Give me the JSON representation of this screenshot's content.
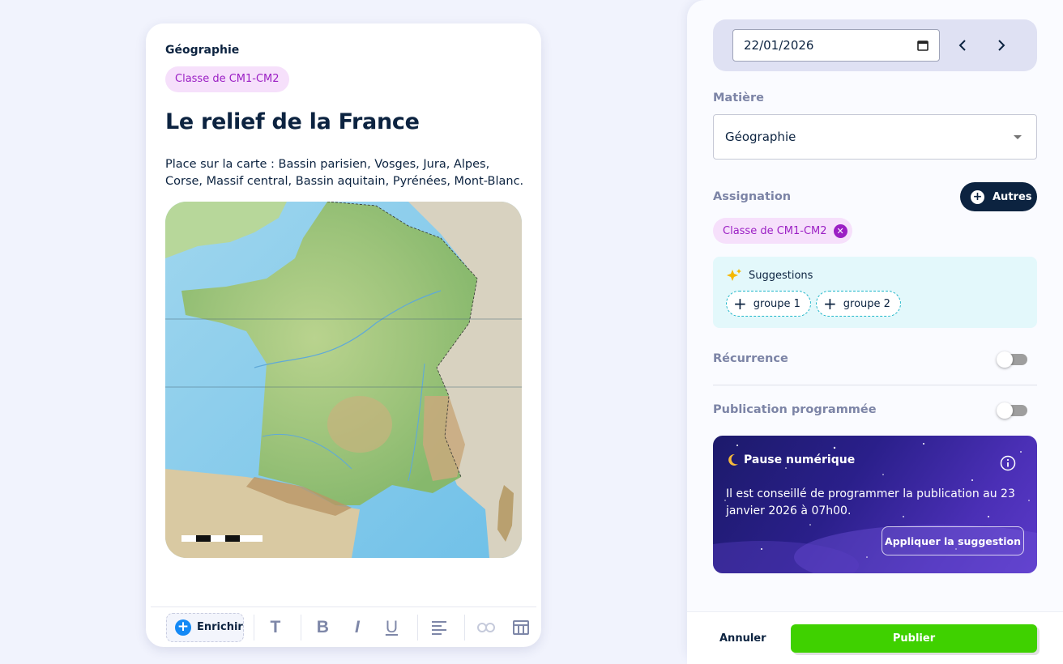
{
  "card": {
    "subject": "Géographie",
    "class_tag": "Classe de CM1-CM2",
    "title": "Le relief de la France",
    "description": "Place sur la carte : Bassin parisien, Vosges, Jura, Alpes, Corse, Massif central, Bassin aquitain, Pyrénées, Mont-Blanc.",
    "image_icon": "map-of-france-relief",
    "toolbar": {
      "enrich_label": "Enrichir",
      "tools": [
        "text-icon",
        "bold-icon",
        "italic-icon",
        "underline-icon",
        "align-left-icon",
        "link-icon",
        "table-icon"
      ]
    }
  },
  "panel": {
    "date_value": "22/01/2026",
    "matiere_label": "Matière",
    "matiere_value": "Géographie",
    "assignation_label": "Assignation",
    "autres_label": "Autres",
    "assigned_chip": "Classe de CM1-CM2",
    "suggestions_label": "Suggestions",
    "suggestions": [
      "groupe 1",
      "groupe 2"
    ],
    "recurrence_label": "Récurrence",
    "recurrence_on": false,
    "scheduled_label": "Publication programmée",
    "scheduled_on": false,
    "pause": {
      "title": "Pause numérique",
      "text": "Il est conseillé de programmer la publication au 23 janvier 2026 à 07h00.",
      "button": "Appliquer la suggestion"
    },
    "cancel_label": "Annuler",
    "publish_label": "Publier"
  },
  "colors": {
    "page_bg": "#f1f3fd",
    "navy": "#0c2340",
    "purple_tag": "#9b1fc4",
    "tag_bg": "#f6e0fb",
    "publish_green": "#3fd100",
    "suggest_bg": "#e3f8fb",
    "enrich_blue": "#1489f5"
  }
}
